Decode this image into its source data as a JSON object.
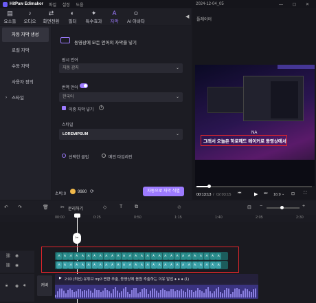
{
  "titlebar": {
    "app_name": "HitPaw Edimakor",
    "menu": [
      "파일",
      "설정",
      "도움"
    ],
    "date": "2024-12-04_05",
    "controls": "— ▢ ✕"
  },
  "toolbar": {
    "tools": [
      {
        "label": "요소들",
        "icon": "▤",
        "name": "tool-elements",
        "active": false
      },
      {
        "label": "오디오",
        "icon": "♪",
        "name": "tool-audio",
        "active": false
      },
      {
        "label": "화면전환",
        "icon": "⇄",
        "name": "tool-transition",
        "active": false
      },
      {
        "label": "필터",
        "icon": "◐",
        "name": "tool-filter",
        "active": false
      },
      {
        "label": "특수효과",
        "icon": "✦",
        "name": "tool-effects",
        "active": false
      },
      {
        "label": "자막",
        "icon": "A",
        "name": "tool-subtitle",
        "active": true
      },
      {
        "label": "AI 아바타",
        "icon": "☺",
        "name": "tool-ai-avatar",
        "active": false
      }
    ]
  },
  "leftnav": {
    "items": [
      {
        "label": "자동 자막 생성",
        "active": true
      },
      {
        "label": "로컬 자막",
        "active": false
      },
      {
        "label": "수동 자막",
        "active": false
      },
      {
        "label": "사용자 정의",
        "active": false
      },
      {
        "label": "스타일",
        "active": false,
        "caret": true
      }
    ]
  },
  "settings": {
    "banner": "동영상에 모든 언어의 자막을 넣기",
    "source_language_label": "원시 언어",
    "source_language_value": "자동 감지",
    "translate_label": "번역 언어",
    "translate_value": "한국어",
    "dual_subtitle_label": "이중 자막 넣기",
    "style_label": "스타일",
    "style_value": "LOREMIPSUM",
    "radio_selected_clip": "선택한 클립",
    "radio_main_timeline": "메인 타임라인",
    "cost_label": "소비:0",
    "credits": "9980",
    "generate_button": "자동으로 자막 식별"
  },
  "player": {
    "title": "플레이어",
    "subtitle_top": "NA",
    "subtitle_main": "그래서 오늘은 하로헤드 메이커로 동영상에서",
    "current_time": "00:13:13",
    "total_time": "02:03:15",
    "aspect": "16:9",
    "progress": 0.12
  },
  "timeline": {
    "split_label": "분리하기",
    "ruler_ticks": [
      "00:00",
      "0:25",
      "0:50",
      "1:15",
      "1:40",
      "2:05",
      "2:30"
    ],
    "clip_text": "2:03 (최신) 유튜브 mp3 변환 추출, 동영상에 음원 추출하는 이유 말업 ● ● ● (1)",
    "cover_label": "커버",
    "subtitle_chip_char": "ㅊ"
  },
  "colors": {
    "accent": "#9d7bff",
    "highlight_red": "#e0252b",
    "subtitle_teal": "#2a8c8c",
    "audio_purple": "#4a3f9e"
  }
}
